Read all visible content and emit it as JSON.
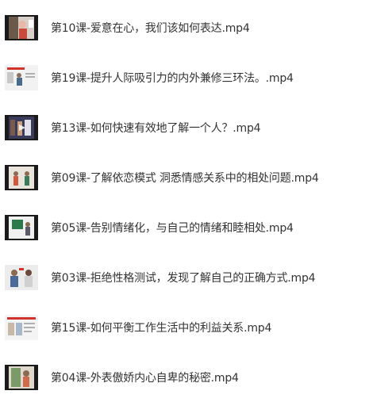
{
  "files": [
    {
      "name": "第10课-爱意在心，我们该如何表达.mp4",
      "thumb": "video-thumbnail-dark-frame"
    },
    {
      "name": "第19课-提升人际吸引力的内外兼修三环法。.mp4",
      "thumb": "video-thumbnail-light-slide"
    },
    {
      "name": "第13课-如何快速有效地了解一个人？.mp4",
      "thumb": "video-thumbnail-dark-frame"
    },
    {
      "name": "第09课-了解依恋模式 洞悉情感关系中的相处问题.mp4",
      "thumb": "video-thumbnail-dark-frame"
    },
    {
      "name": "第05课-告别情绪化，与自己的情绪和睦相处.mp4",
      "thumb": "video-thumbnail-dark-frame"
    },
    {
      "name": "第03课-拒绝性格测试，发现了解自己的正确方式.mp4",
      "thumb": "video-thumbnail-light-slide"
    },
    {
      "name": "第15课-如何平衡工作生活中的利益关系.mp4",
      "thumb": "video-thumbnail-light-slide"
    },
    {
      "name": "第04课-外表傲娇内心自卑的秘密.mp4",
      "thumb": "video-thumbnail-dark-frame"
    }
  ],
  "colors": {
    "text": "#333333",
    "thumb_dark": "#1a1a1a",
    "thumb_light": "#f2f2f2",
    "accent_red": "#d0342c"
  }
}
